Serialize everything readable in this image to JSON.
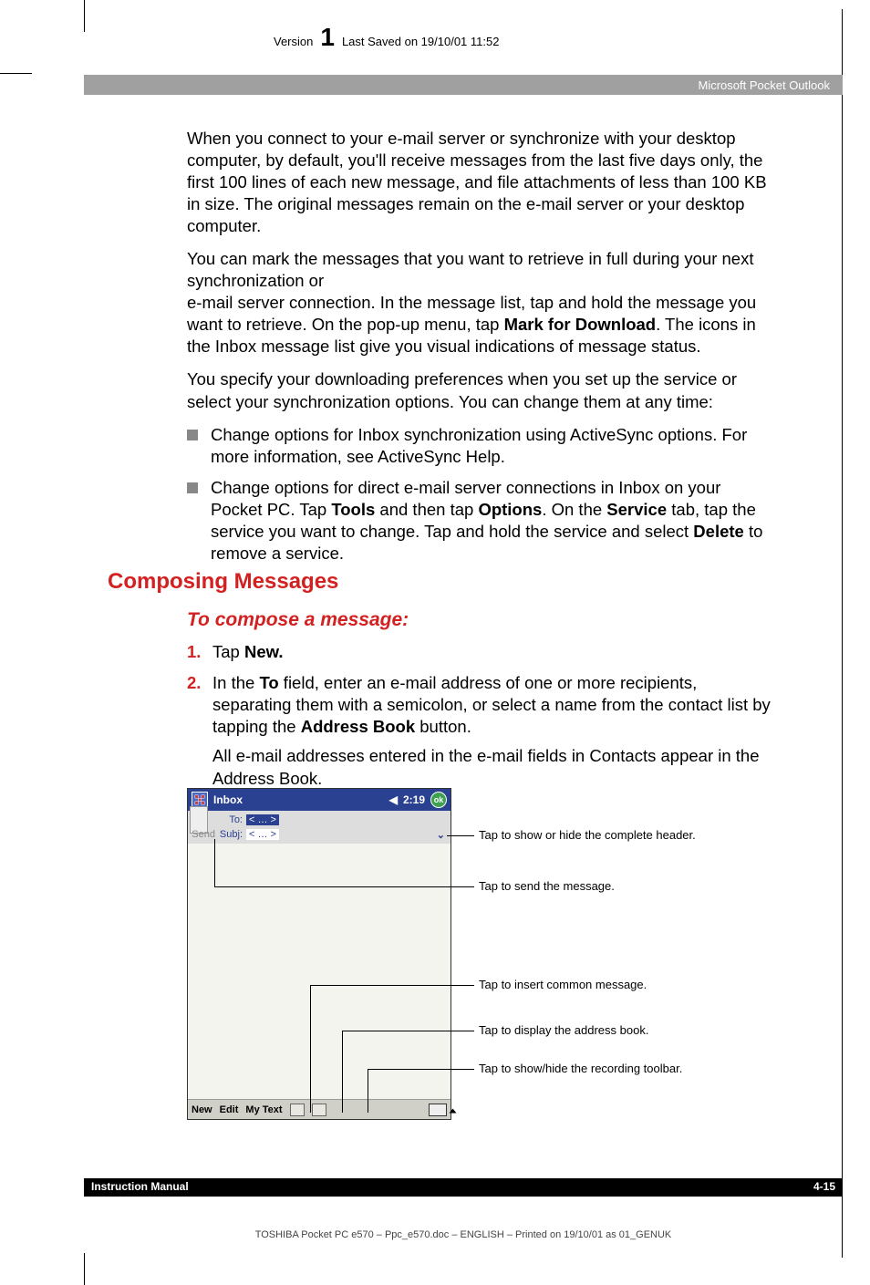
{
  "meta": {
    "version_label": "Version",
    "version_number": "1",
    "saved": "Last Saved on 19/10/01 11:52"
  },
  "header": {
    "section": "Microsoft Pocket Outlook"
  },
  "body": {
    "p1": "When you connect to your e-mail server or synchronize with your desktop computer, by default, you'll receive messages from the last five days only, the first 100 lines of each new message, and file attachments of less than 100 KB in size. The original messages remain on the e-mail server or your desktop computer.",
    "p2a": "You can mark the messages that you want to retrieve in full during your next synchronization or",
    "p2b_pre": "e-mail server connection. In the message list, tap and hold the message you want to retrieve. On the pop-up menu, tap ",
    "p2b_bold": "Mark for Download",
    "p2b_post": ". The icons in the Inbox message list give you visual indications of message status.",
    "p3": "You specify your downloading preferences when you set up the service or select your synchronization options. You can change them at any time:",
    "bullet1": "Change options for Inbox synchronization using ActiveSync options. For more information, see ActiveSync Help.",
    "bullet2_pre": "Change options for direct e-mail server connections in Inbox on your Pocket PC. Tap ",
    "bullet2_b1": "Tools",
    "bullet2_mid1": " and then tap ",
    "bullet2_b2": "Options",
    "bullet2_mid2": ". On the ",
    "bullet2_b3": "Service",
    "bullet2_mid3": " tab, tap the service you want to change. Tap and hold the service and select ",
    "bullet2_b4": "Delete",
    "bullet2_post": " to remove a service."
  },
  "h2": "Composing Messages",
  "sub": "To compose a message:",
  "steps": {
    "s1_pre": "Tap ",
    "s1_b": "New.",
    "s2_pre": "In the ",
    "s2_b1": "To",
    "s2_mid": " field, enter an e-mail address of one or more recipients, separating them with a semicolon, or select a name from the contact list by tapping the ",
    "s2_b2": "Address Book",
    "s2_post": " button.",
    "s2_p2": "All e-mail addresses entered in the e-mail fields in Contacts appear in the Address Book."
  },
  "screenshot": {
    "title": "Inbox",
    "time": "2:19",
    "ok": "ok",
    "to_label": "To:",
    "to_value": "< … >",
    "subj_label": "Subj:",
    "subj_value": "< … >",
    "send": "Send",
    "menu_new": "New",
    "menu_edit": "Edit",
    "menu_mytext": "My Text"
  },
  "callouts": {
    "c1": "Tap to show or hide the complete header.",
    "c2": "Tap to send the message.",
    "c3": "Tap to insert common message.",
    "c4": "Tap to display the address book.",
    "c5": "Tap to show/hide the recording toolbar."
  },
  "footer": {
    "left": "Instruction Manual",
    "right": "4-15",
    "print": "TOSHIBA Pocket PC e570  – Ppc_e570.doc – ENGLISH – Printed on 19/10/01 as 01_GENUK"
  }
}
